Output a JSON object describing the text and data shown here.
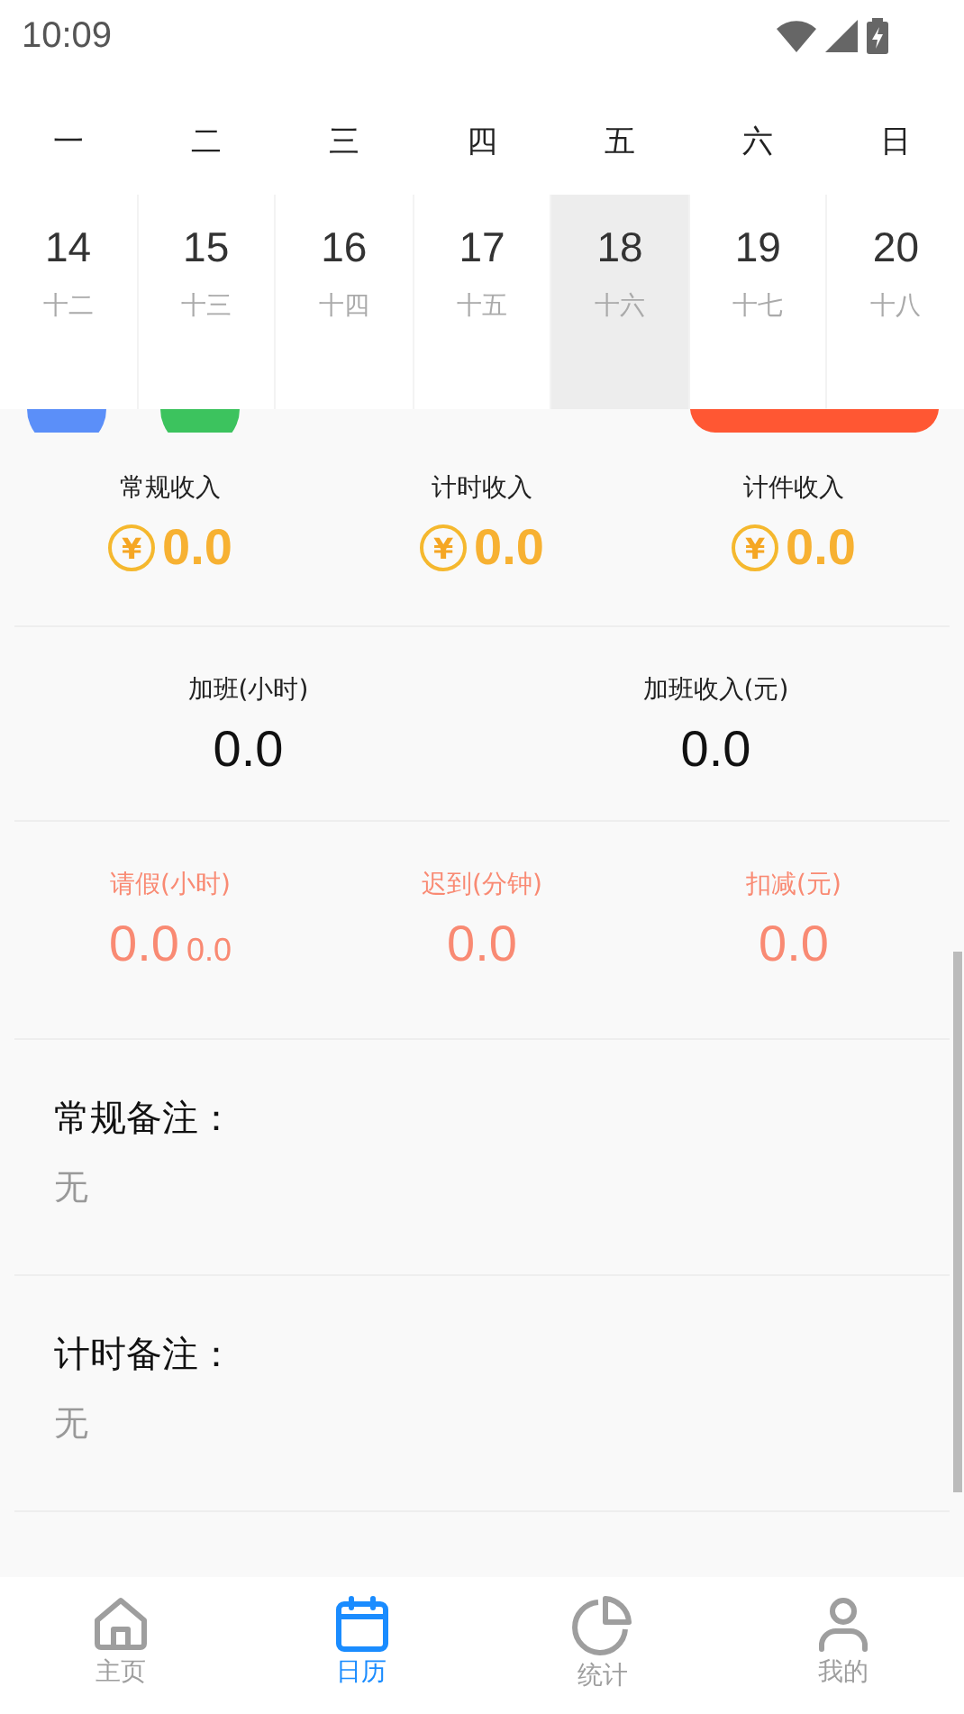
{
  "status_bar": {
    "time": "10:09"
  },
  "weekdays": [
    "一",
    "二",
    "三",
    "四",
    "五",
    "六",
    "日"
  ],
  "days": [
    {
      "date": "14",
      "lunar": "十二",
      "selected": false,
      "marker": {
        "kind": "dot",
        "color": "#5b8ff9"
      }
    },
    {
      "date": "15",
      "lunar": "十三",
      "selected": false,
      "marker": {
        "kind": "dot",
        "color": "#3cc35e"
      }
    },
    {
      "date": "16",
      "lunar": "十四",
      "selected": false
    },
    {
      "date": "17",
      "lunar": "十五",
      "selected": false
    },
    {
      "date": "18",
      "lunar": "十六",
      "selected": true
    },
    {
      "date": "19",
      "lunar": "十七",
      "selected": false,
      "marker": {
        "kind": "bar-start",
        "color": "#ff5733"
      }
    },
    {
      "date": "20",
      "lunar": "十八",
      "selected": false,
      "marker": {
        "kind": "bar-end",
        "color": "#ff5733"
      }
    }
  ],
  "income": [
    {
      "label": "常规收入",
      "currency": "¥",
      "value": "0.0"
    },
    {
      "label": "计时收入",
      "currency": "¥",
      "value": "0.0"
    },
    {
      "label": "计件收入",
      "currency": "¥",
      "value": "0.0"
    }
  ],
  "overtime": [
    {
      "label": "加班(小时)",
      "value": "0.0"
    },
    {
      "label": "加班收入(元)",
      "value": "0.0"
    }
  ],
  "deductions": [
    {
      "label": "请假(小时)",
      "value": "0.0",
      "sub_value": "0.0"
    },
    {
      "label": "迟到(分钟)",
      "value": "0.0"
    },
    {
      "label": "扣减(元)",
      "value": "0.0"
    }
  ],
  "notes": [
    {
      "title": "常规备注：",
      "text": "无"
    },
    {
      "title": "计时备注：",
      "text": "无"
    }
  ],
  "nav": [
    {
      "label": "主页",
      "kind": "home",
      "selected": false
    },
    {
      "label": "日历",
      "kind": "calendar",
      "selected": true
    },
    {
      "label": "统计",
      "kind": "chart",
      "selected": false
    },
    {
      "label": "我的",
      "kind": "profile",
      "selected": false
    }
  ]
}
